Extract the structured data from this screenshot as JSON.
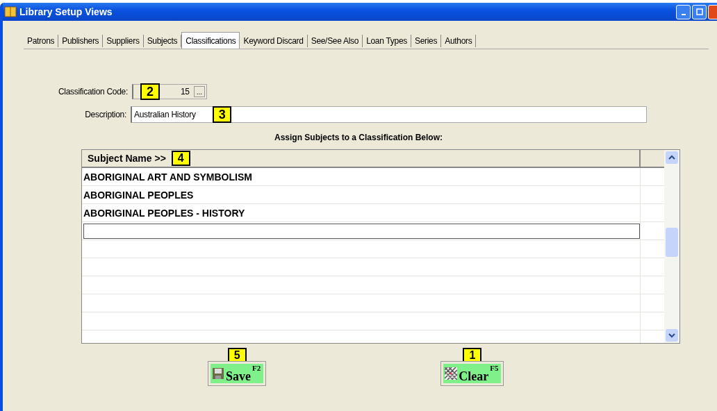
{
  "window": {
    "title": "Library Setup Views"
  },
  "tabs": [
    {
      "label": "Patrons",
      "selected": false
    },
    {
      "label": "Publishers",
      "selected": false
    },
    {
      "label": "Suppliers",
      "selected": false
    },
    {
      "label": "Subjects",
      "selected": false
    },
    {
      "label": "Classifications",
      "selected": true
    },
    {
      "label": "Keyword Discard",
      "selected": false
    },
    {
      "label": "See/See Also",
      "selected": false
    },
    {
      "label": "Loan Types",
      "selected": false
    },
    {
      "label": "Series",
      "selected": false
    },
    {
      "label": "Authors",
      "selected": false
    }
  ],
  "classification_code": {
    "label": "Classification Code:",
    "value": "15",
    "browse": "...",
    "callout": "2"
  },
  "description": {
    "label": "Description:",
    "value": "Australian History",
    "callout": "3"
  },
  "grid": {
    "heading": "Assign Subjects to a Classification Below:",
    "column": "Subject Name >>",
    "callout": "4",
    "rows": [
      {
        "subject": "ABORIGINAL ART AND SYMBOLISM"
      },
      {
        "subject": "ABORIGINAL PEOPLES"
      },
      {
        "subject": "ABORIGINAL PEOPLES - HISTORY"
      }
    ]
  },
  "buttons": [
    {
      "kind": "save",
      "label": "Save",
      "key": "F2",
      "callout": "5"
    },
    {
      "kind": "clear",
      "label": "Clear",
      "key": "F5",
      "callout": "1"
    }
  ]
}
